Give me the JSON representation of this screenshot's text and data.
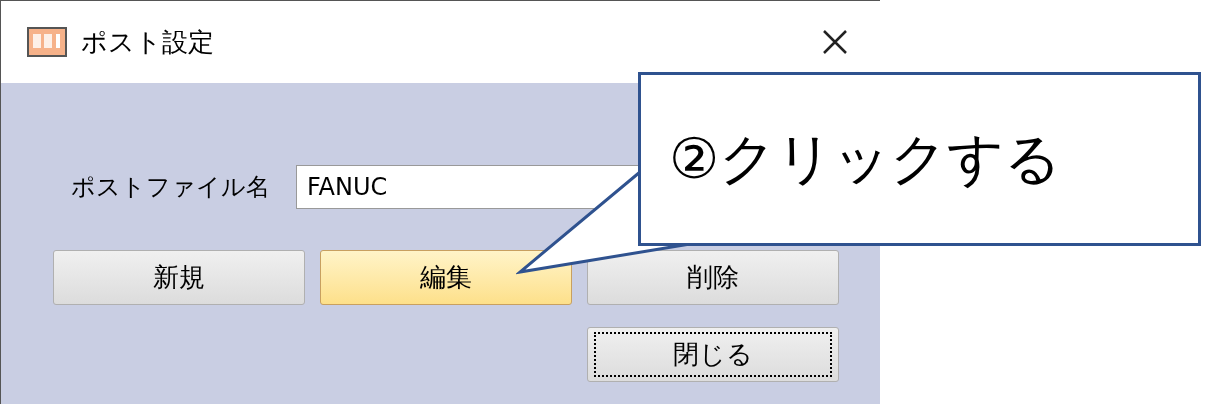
{
  "window": {
    "title": "ポスト設定"
  },
  "field": {
    "label": "ポストファイル名",
    "value": "FANUC"
  },
  "buttons": [
    {
      "label": "新規",
      "highlighted": false,
      "focused": false
    },
    {
      "label": "編集",
      "highlighted": true,
      "focused": false
    },
    {
      "label": "削除",
      "highlighted": false,
      "focused": false
    }
  ],
  "close_button": {
    "label": "閉じる",
    "highlighted": false,
    "focused": true
  },
  "callout": {
    "text": "②クリックする"
  }
}
